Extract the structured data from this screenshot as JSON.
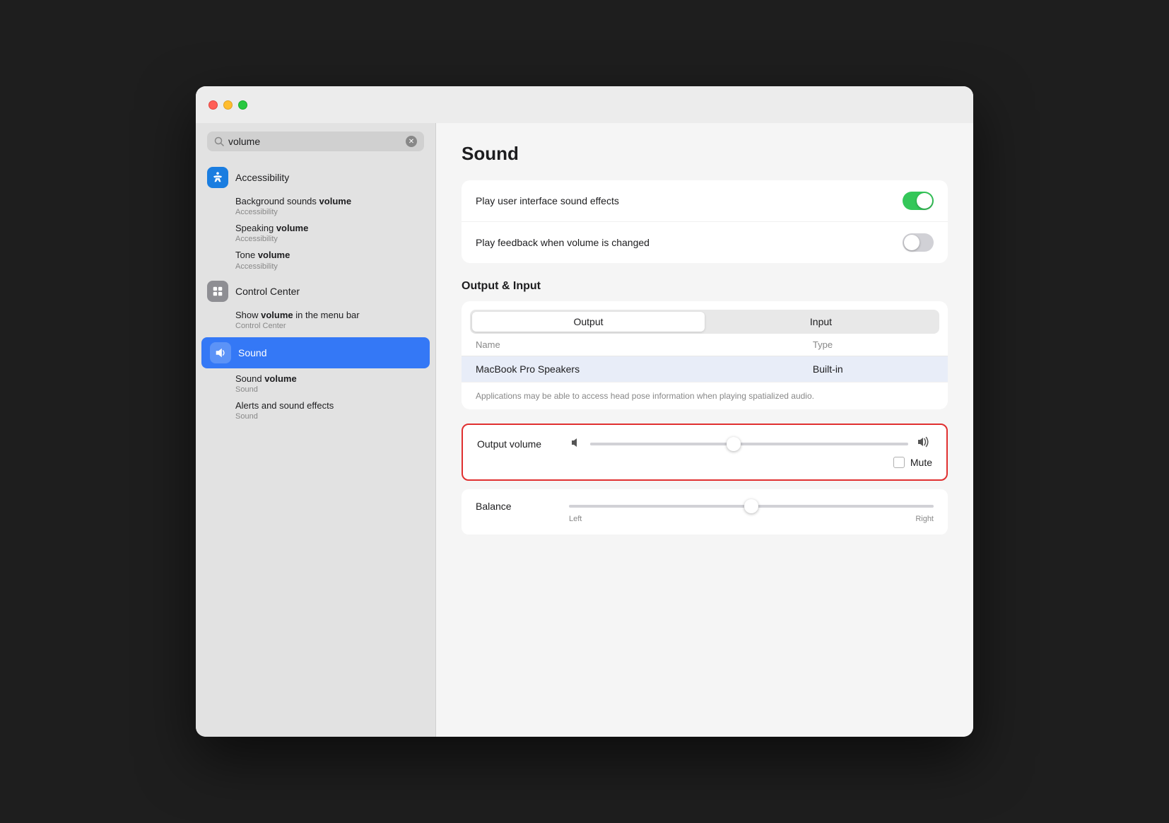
{
  "window": {
    "title": "Sound"
  },
  "titlebar": {
    "close_label": "",
    "minimize_label": "",
    "maximize_label": ""
  },
  "sidebar": {
    "search": {
      "value": "volume",
      "placeholder": "Search"
    },
    "sections": [
      {
        "id": "accessibility",
        "icon": "♿",
        "icon_color": "accessibility",
        "label": "Accessibility",
        "children": [
          {
            "id": "bg-sounds",
            "title_plain": "Background sounds ",
            "title_bold": "volume",
            "subtitle": "Accessibility"
          },
          {
            "id": "speaking",
            "title_plain": "Speaking ",
            "title_bold": "volume",
            "subtitle": "Accessibility"
          },
          {
            "id": "tone",
            "title_plain": "Tone ",
            "title_bold": "volume",
            "subtitle": "Accessibility"
          }
        ]
      },
      {
        "id": "control-center",
        "icon": "⊞",
        "icon_color": "control-center",
        "label": "Control Center",
        "children": [
          {
            "id": "show-volume",
            "title_plain": "Show ",
            "title_bold": "volume",
            "title_after": " in the menu bar",
            "subtitle": "Control Center"
          }
        ]
      },
      {
        "id": "sound",
        "icon": "🔊",
        "icon_color": "sound",
        "label": "Sound",
        "active": true,
        "children": [
          {
            "id": "sound-volume",
            "title_plain": "Sound ",
            "title_bold": "volume",
            "subtitle": "Sound"
          },
          {
            "id": "alerts",
            "title_plain": "Alerts and sound effects",
            "title_bold": "",
            "subtitle": "Sound"
          }
        ]
      }
    ]
  },
  "main": {
    "title": "Sound",
    "settings": {
      "play_ui_sounds_label": "Play user interface sound effects",
      "play_ui_sounds_on": true,
      "play_feedback_label": "Play feedback when volume is changed",
      "play_feedback_on": false
    },
    "output_input": {
      "section_label": "Output & Input",
      "tab_output": "Output",
      "tab_input": "Input",
      "active_tab": "Output",
      "table": {
        "col_name": "Name",
        "col_type": "Type",
        "rows": [
          {
            "name": "MacBook Pro Speakers",
            "type": "Built-in",
            "selected": true
          }
        ]
      },
      "disclaimer": "Applications may be able to access head pose information when playing spatialized audio."
    },
    "output_volume": {
      "label": "Output volume",
      "slider_pct": 45,
      "mute_label": "Mute"
    },
    "balance": {
      "label": "Balance",
      "left_label": "Left",
      "right_label": "Right",
      "slider_pct": 50
    }
  }
}
